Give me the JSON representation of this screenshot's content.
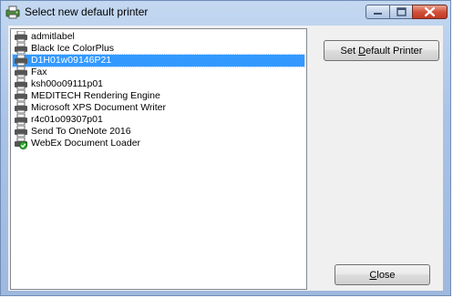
{
  "window": {
    "title": "Select new default printer",
    "app_icon": "printer-settings-icon",
    "caption_buttons": [
      "minimize-icon",
      "maximize-icon",
      "close-icon"
    ]
  },
  "printers": [
    {
      "name": "admitlabel",
      "icon": "printer-icon",
      "selected": false
    },
    {
      "name": "Black Ice ColorPlus",
      "icon": "printer-icon",
      "selected": false
    },
    {
      "name": "D1H01w09146P21",
      "icon": "printer-icon",
      "selected": true
    },
    {
      "name": "Fax",
      "icon": "printer-icon",
      "selected": false
    },
    {
      "name": "ksh00o09111p01",
      "icon": "printer-icon",
      "selected": false
    },
    {
      "name": "MEDITECH Rendering Engine",
      "icon": "printer-icon",
      "selected": false
    },
    {
      "name": "Microsoft XPS Document Writer",
      "icon": "printer-icon",
      "selected": false
    },
    {
      "name": "r4c01o09307p01",
      "icon": "printer-icon",
      "selected": false
    },
    {
      "name": "Send To OneNote 2016",
      "icon": "printer-icon",
      "selected": false
    },
    {
      "name": "WebEx Document Loader",
      "icon": "default-printer-check-icon",
      "selected": false
    }
  ],
  "buttons": {
    "set_default": {
      "prefix": "Set ",
      "accel": "D",
      "suffix": "efault Printer"
    },
    "close": {
      "prefix": "",
      "accel": "C",
      "suffix": "lose"
    }
  },
  "colors": {
    "selection": "#3399ff",
    "title_gradient_top": "#c4d8f1",
    "close_button": "#c13a23"
  }
}
